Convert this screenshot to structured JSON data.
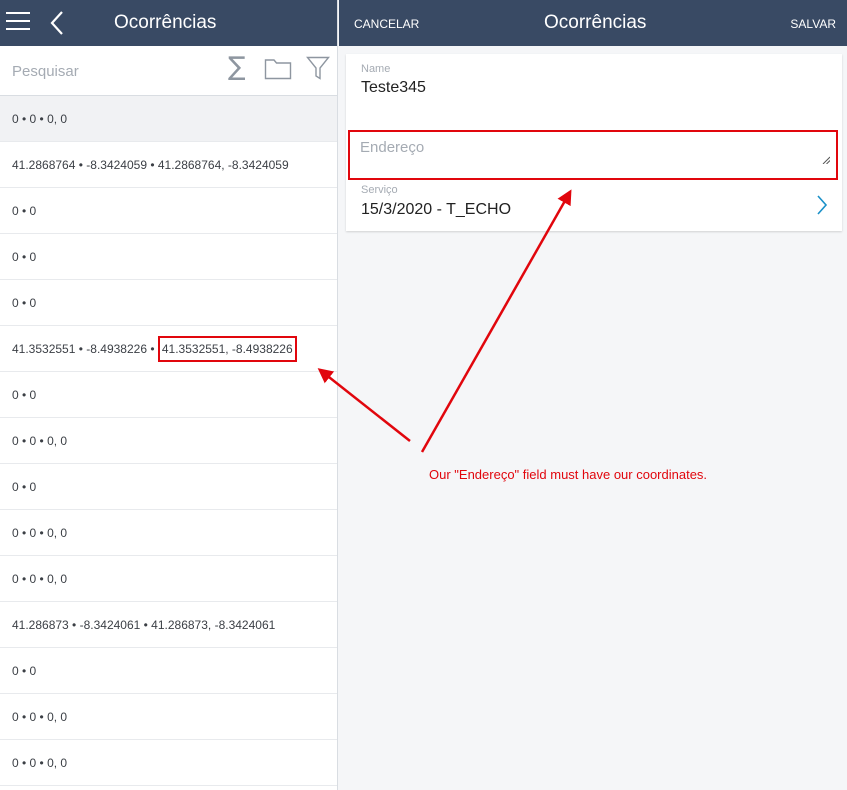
{
  "left": {
    "title": "Ocorrências",
    "search_placeholder": "Pesquisar",
    "sum_symbol": "∑",
    "rows": [
      "0 • 0 • 0, 0",
      "41.2868764 • -8.3424059 • 41.2868764, -8.3424059",
      "0 • 0",
      "0 • 0",
      "0 • 0",
      "0 • 0",
      "0 • 0 • 0, 0",
      "0 • 0",
      "0 • 0 • 0, 0",
      "0 • 0 • 0, 0",
      "41.286873 • -8.3424061 • 41.286873, -8.3424061",
      "0 • 0",
      "0 • 0 • 0, 0",
      "0 • 0 • 0, 0"
    ],
    "highlight_row": {
      "prefix": "41.3532551 • -8.4938226 • ",
      "coords": "41.3532551, -8.4938226"
    }
  },
  "right": {
    "cancel_label": "CANCELAR",
    "title": "Ocorrências",
    "save_label": "SALVAR",
    "name_label": "Name",
    "name_value": "Teste345",
    "address_placeholder": "Endereço",
    "service_label": "Serviço",
    "service_value": "15/3/2020 - T_ECHO"
  },
  "annotation": {
    "text": "Our \"Endereço\" field must have our coordinates.",
    "color": "#e1060d"
  },
  "colors": {
    "header_bg": "#394a64",
    "accent_blue": "#1a90c8"
  }
}
